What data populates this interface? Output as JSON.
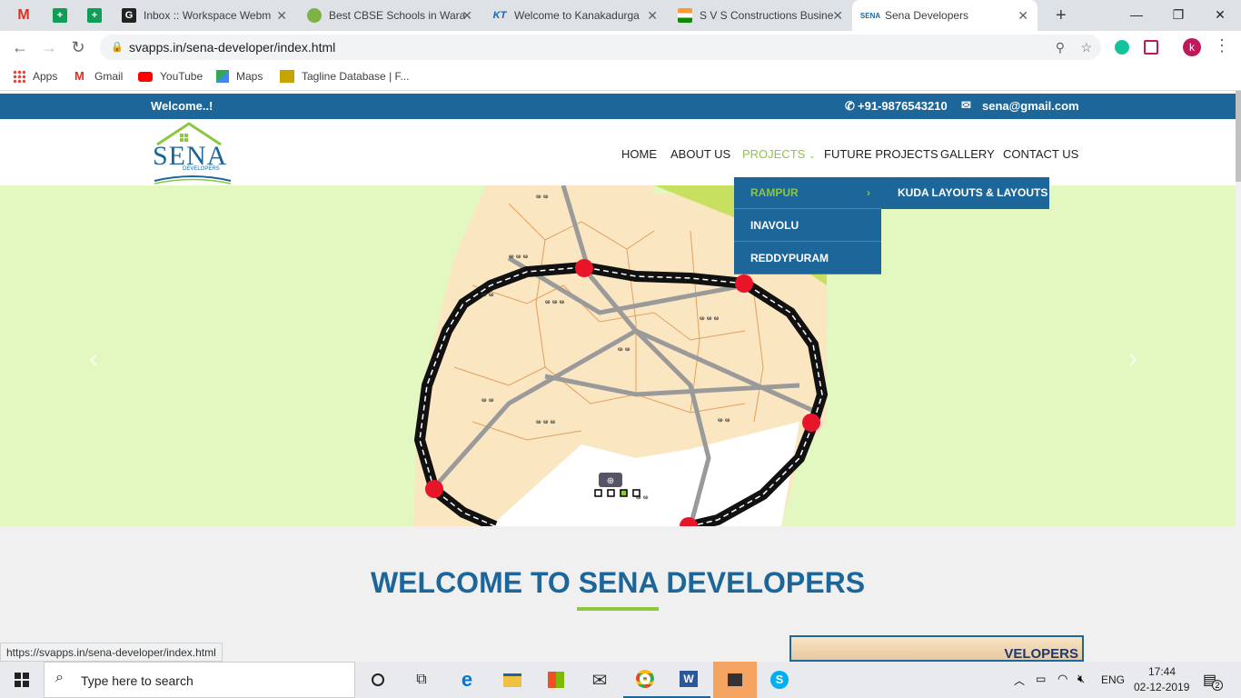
{
  "browser": {
    "tabs": [
      {
        "title": "",
        "icon": "gmail-icon"
      },
      {
        "title": "",
        "icon": "sheets-icon"
      },
      {
        "title": "",
        "icon": "sheets-icon"
      },
      {
        "title": "Inbox :: Workspace Webm",
        "icon": "g-icon"
      },
      {
        "title": "Best CBSE Schools in Wara",
        "icon": "leaf-icon"
      },
      {
        "title": "Welcome to Kanakadurga",
        "icon": "kt-icon"
      },
      {
        "title": "S V S Constructions Busine",
        "icon": "flag-icon"
      },
      {
        "title": "Sena Developers",
        "icon": "sena-icon"
      }
    ],
    "new_tab_label": "+",
    "url": "svapps.in/sena-developer/index.html",
    "bookmarks": [
      {
        "label": "Apps"
      },
      {
        "label": "Gmail"
      },
      {
        "label": "YouTube"
      },
      {
        "label": "Maps"
      },
      {
        "label": "Tagline Database | F..."
      }
    ],
    "profile_initial": "k",
    "status_url": "https://svapps.in/sena-developer/index.html"
  },
  "site": {
    "welcome_text": "Welcome..!",
    "phone": "+91-9876543210",
    "email": "sena@gmail.com",
    "logo": {
      "name": "SENA",
      "sub": "DEVELOPERS"
    },
    "menu": [
      "HOME",
      "ABOUT US",
      "PROJECTS",
      "FUTURE PROJECTS",
      "GALLERY",
      "CONTACT US"
    ],
    "active_menu": "PROJECTS",
    "dropdown": [
      "RAMPUR",
      "INAVOLU",
      "REDDYPURAM"
    ],
    "submenu": [
      "KUDA LAYOUTS & LAYOUTS"
    ],
    "welcome_heading": "WELCOME TO SENA DEVELOPERS",
    "thumb_caption": "VELOPERS",
    "colors": {
      "primary": "#1c6699",
      "accent": "#8dc63f",
      "hero_bg": "#e2f8c0"
    }
  },
  "taskbar": {
    "search_placeholder": "Type here to search",
    "lang": "ENG",
    "time": "17:44",
    "date": "02-12-2019",
    "notif_count": "2"
  }
}
